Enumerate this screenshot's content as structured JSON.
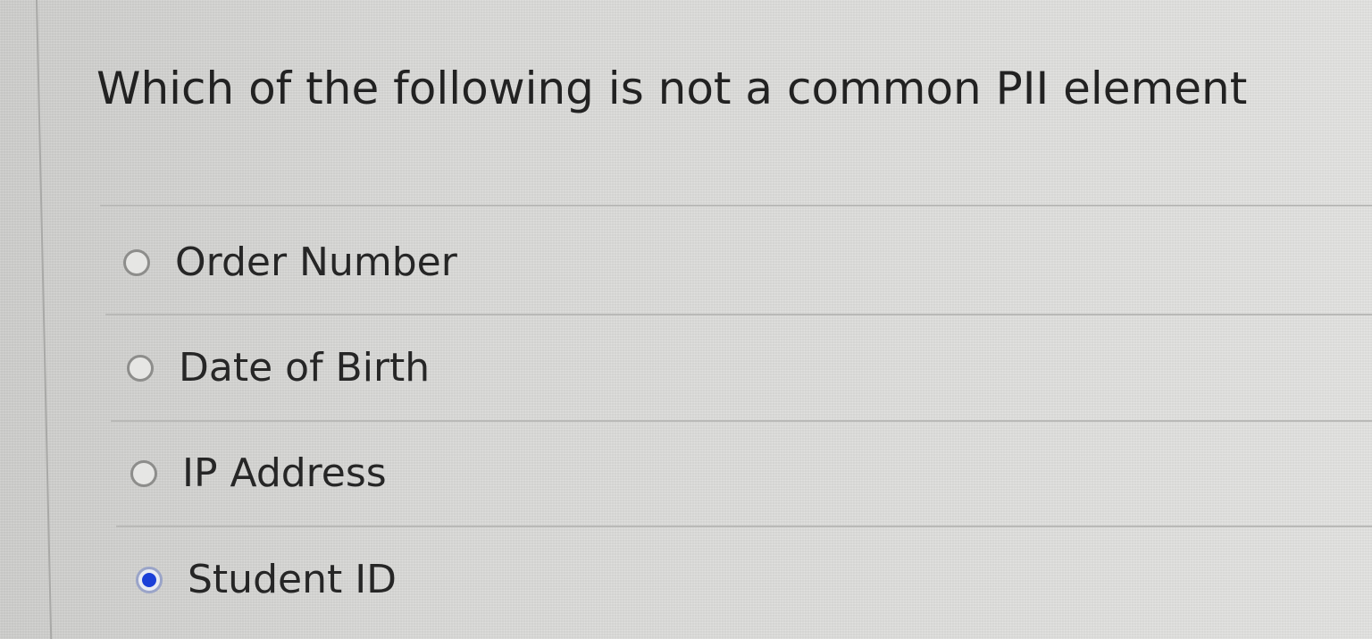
{
  "question": {
    "title": "Which of the following is not a common  PII element"
  },
  "options": [
    {
      "label": "Order Number",
      "selected": false
    },
    {
      "label": "Date of Birth",
      "selected": false
    },
    {
      "label": "IP Address",
      "selected": false
    },
    {
      "label": "Student ID",
      "selected": true
    }
  ],
  "colors": {
    "selected_radio": "#1b3fd8",
    "text": "#222222",
    "background": "#dcdcda"
  }
}
